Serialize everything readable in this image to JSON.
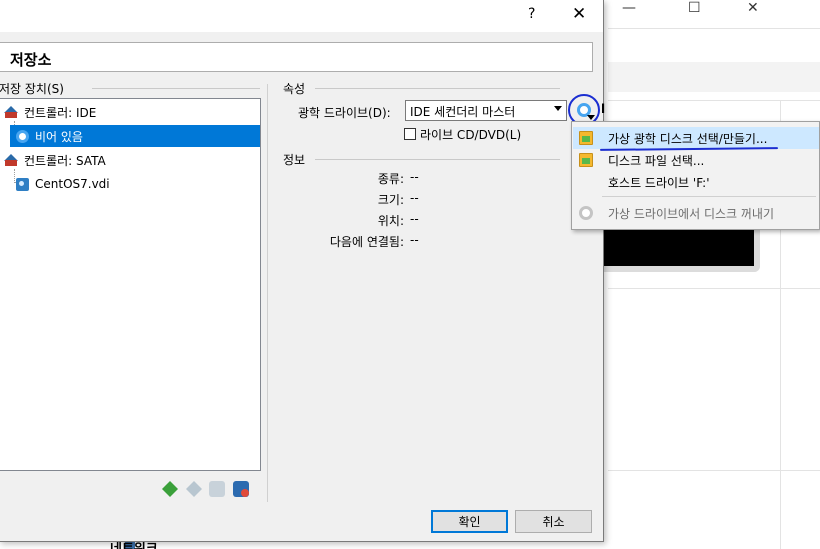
{
  "background_window": {
    "min_glyph": "—",
    "max_glyph": "☐",
    "close_glyph": "✕",
    "bottom_label": "네트워크"
  },
  "dialog": {
    "help_glyph": "?",
    "close_glyph": "✕",
    "title": "저장소"
  },
  "storage": {
    "section_label": "저장 장치(S)",
    "tree": [
      {
        "label": "컨트롤러: IDE",
        "type": "controller"
      },
      {
        "label": "비어 있음",
        "type": "optical",
        "selected": true
      },
      {
        "label": "컨트롤러: SATA",
        "type": "controller"
      },
      {
        "label": "CentOS7.vdi",
        "type": "hdd"
      }
    ]
  },
  "properties": {
    "section_label": "속성",
    "drive_label": "광학 드라이브(D):",
    "drive_value": "IDE 세컨더리 마스터",
    "live_cd_label": "라이브 CD/DVD(L)",
    "live_cd_checked": false,
    "partial_text": "l"
  },
  "info": {
    "section_label": "정보",
    "rows": [
      {
        "key": "종류:",
        "value": "--"
      },
      {
        "key": "크기:",
        "value": "--"
      },
      {
        "key": "위치:",
        "value": "--"
      },
      {
        "key": "다음에 연결됨:",
        "value": "--"
      }
    ]
  },
  "buttons": {
    "ok": "확인",
    "cancel": "취소"
  },
  "context_menu": {
    "items": [
      {
        "label": "가상 광학 디스크 선택/만들기...",
        "icon": "folder-icon",
        "highlighted": true
      },
      {
        "label": "디스크 파일 선택...",
        "icon": "folder-icon"
      },
      {
        "label": "호스트 드라이브 'F:'",
        "icon": ""
      },
      {
        "label": "가상 드라이브에서 디스크 꺼내기",
        "icon": "disc-remove-icon",
        "disabled": true
      }
    ]
  },
  "colors": {
    "selection": "#0078d7",
    "annotation_pen": "#1b2ed1",
    "menu_highlight": "#cde8ff"
  }
}
